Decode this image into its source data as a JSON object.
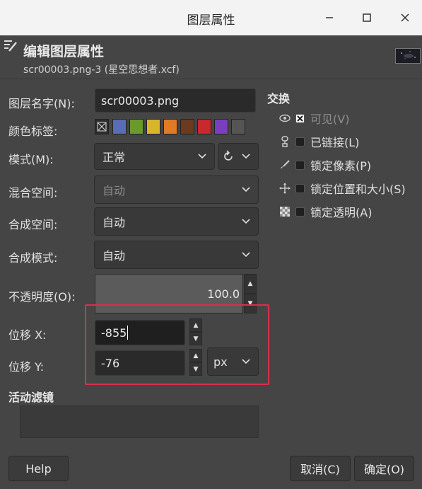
{
  "window": {
    "title": "图层属性",
    "min_icon": "minimize-icon",
    "max_icon": "maximize-icon",
    "close_icon": "close-icon"
  },
  "header": {
    "title": "编辑图层属性",
    "subtitle": "scr00003.png-3 (星空思想者.xcf)",
    "icon": "edit-icon"
  },
  "form": {
    "name_label": "图层名字(N):",
    "name_value": "scr00003.png",
    "color_tag_label": "颜色标签:",
    "color_tags": [
      "#5a6bb8",
      "#6b9a2c",
      "#d9b52a",
      "#e07a25",
      "#6b3a1f",
      "#c8282e",
      "#7a3fbf",
      "#555555"
    ],
    "mode_label": "模式(M):",
    "mode_value": "正常",
    "blend_space_label": "混合空间:",
    "blend_space_value": "自动",
    "composite_space_label": "合成空间:",
    "composite_space_value": "自动",
    "composite_mode_label": "合成模式:",
    "composite_mode_value": "自动",
    "opacity_label": "不透明度(O):",
    "opacity_value": "100.0",
    "offset_x_label": "位移 X:",
    "offset_x_value": "-855",
    "offset_y_label": "位移 Y:",
    "offset_y_value": "-76",
    "unit_value": "px",
    "filters_label": "活动滤镜"
  },
  "switches": {
    "title": "交换",
    "visible": {
      "label": "可见(V)",
      "checked": true,
      "icon": "eye-icon"
    },
    "linked": {
      "label": "已链接(L)",
      "checked": false,
      "icon": "chain-icon"
    },
    "lock_pixels": {
      "label": "锁定像素(P)",
      "checked": false,
      "icon": "paintbrush-icon"
    },
    "lock_position": {
      "label": "锁定位置和大小(S)",
      "checked": false,
      "icon": "move-icon"
    },
    "lock_alpha": {
      "label": "锁定透明(A)",
      "checked": false,
      "icon": "checkerboard-icon"
    }
  },
  "buttons": {
    "help": "Help",
    "cancel": "取消(C)",
    "ok": "确定(O)"
  },
  "colors": {
    "highlight": "#d9304f",
    "background": "#454545"
  }
}
